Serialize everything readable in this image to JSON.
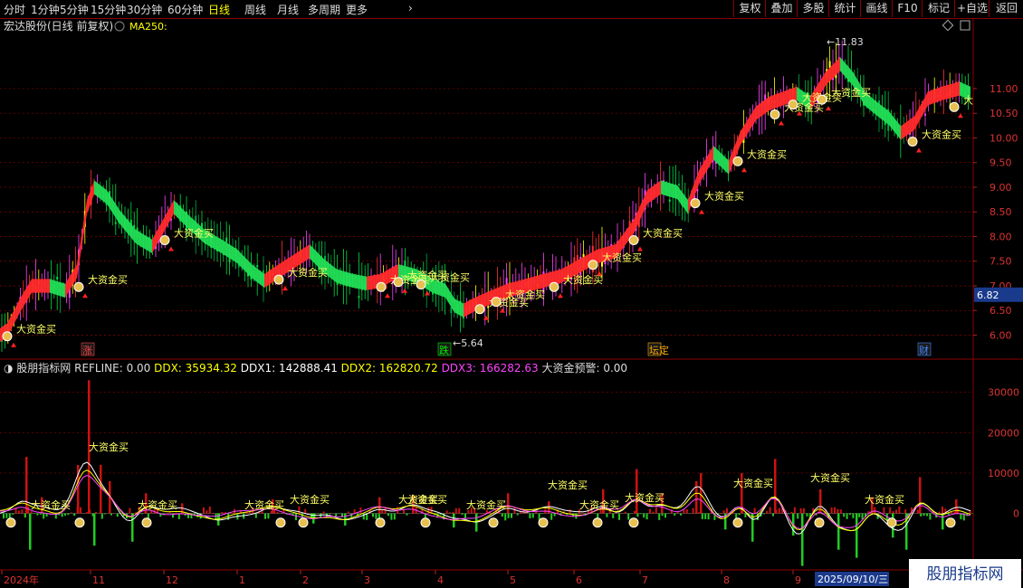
{
  "toolbar": {
    "periods": [
      "分时",
      "1分钟",
      "5分钟",
      "15分钟",
      "30分钟",
      "60分钟",
      "日线",
      "周线",
      "月线",
      "多周期",
      "更多"
    ],
    "active_period": "日线",
    "right_buttons": [
      "复权",
      "叠加",
      "多股",
      "统计",
      "画线",
      "F10",
      "标记",
      "+自选",
      "返回"
    ]
  },
  "main_header": {
    "title": "宏达股份(日线 前复权)",
    "ma_label": "MA250:"
  },
  "sub_header": {
    "name": "股朋指标网",
    "items": [
      {
        "text": "REFLINE: 0.00",
        "color": "#dddddd"
      },
      {
        "text": "DDX: 35934.32",
        "color": "#ffff00"
      },
      {
        "text": "DDX1: 142888.41",
        "color": "#ffffff"
      },
      {
        "text": "DDX2: 162820.72",
        "color": "#ffff00"
      },
      {
        "text": "DDX3: 166282.63",
        "color": "#ff44ff"
      },
      {
        "text": "大资金预警: 0.00",
        "color": "#dddddd"
      }
    ]
  },
  "watermark": {
    "title": "股朋指标网",
    "url": "www.7gpzb.com"
  },
  "chart_data": [
    {
      "type": "candlestick",
      "yticks": [
        6.0,
        6.5,
        7.0,
        7.5,
        8.0,
        8.5,
        9.0,
        9.5,
        10.0,
        10.5,
        11.0
      ],
      "ylim": [
        5.55,
        12.1
      ],
      "current_price": "6.82",
      "annotations": {
        "high": "11.83",
        "low": "5.64"
      },
      "path_points": [
        [
          0,
          6.0
        ],
        [
          8,
          6.1
        ],
        [
          22,
          6.6
        ],
        [
          35,
          7.0
        ],
        [
          55,
          7.0
        ],
        [
          72,
          6.9
        ],
        [
          85,
          7.3
        ],
        [
          96,
          8.6
        ],
        [
          104,
          9.0
        ],
        [
          118,
          8.8
        ],
        [
          132,
          8.4
        ],
        [
          150,
          8.0
        ],
        [
          168,
          7.8
        ],
        [
          180,
          8.2
        ],
        [
          192,
          8.6
        ],
        [
          208,
          8.3
        ],
        [
          226,
          8.0
        ],
        [
          245,
          7.8
        ],
        [
          262,
          7.6
        ],
        [
          278,
          7.3
        ],
        [
          292,
          7.1
        ],
        [
          308,
          7.3
        ],
        [
          325,
          7.5
        ],
        [
          342,
          7.7
        ],
        [
          358,
          7.4
        ],
        [
          372,
          7.2
        ],
        [
          390,
          7.1
        ],
        [
          405,
          7.05
        ],
        [
          420,
          7.1
        ],
        [
          440,
          7.3
        ],
        [
          460,
          7.2
        ],
        [
          478,
          7.0
        ],
        [
          492,
          6.9
        ],
        [
          502,
          6.6
        ],
        [
          512,
          6.5
        ],
        [
          522,
          6.6
        ],
        [
          540,
          6.75
        ],
        [
          560,
          6.9
        ],
        [
          580,
          7.0
        ],
        [
          600,
          7.1
        ],
        [
          620,
          7.2
        ],
        [
          640,
          7.4
        ],
        [
          660,
          7.6
        ],
        [
          680,
          7.7
        ],
        [
          700,
          8.2
        ],
        [
          715,
          8.8
        ],
        [
          730,
          9.0
        ],
        [
          748,
          8.9
        ],
        [
          760,
          8.6
        ],
        [
          772,
          9.2
        ],
        [
          788,
          9.7
        ],
        [
          805,
          9.4
        ],
        [
          818,
          10.0
        ],
        [
          835,
          10.5
        ],
        [
          850,
          10.7
        ],
        [
          865,
          10.8
        ],
        [
          880,
          10.9
        ],
        [
          895,
          10.7
        ],
        [
          912,
          11.2
        ],
        [
          928,
          11.5
        ],
        [
          942,
          11.2
        ],
        [
          955,
          10.8
        ],
        [
          968,
          10.6
        ],
        [
          982,
          10.4
        ],
        [
          995,
          10.1
        ],
        [
          1010,
          10.3
        ],
        [
          1025,
          10.8
        ],
        [
          1040,
          10.9
        ],
        [
          1060,
          11.0
        ],
        [
          1072,
          10.9
        ]
      ],
      "signals": [
        {
          "x": 8,
          "price": 6.05,
          "text": "大资金买"
        },
        {
          "x": 87,
          "price": 7.05,
          "text": "大资金买"
        },
        {
          "x": 182,
          "price": 8.0,
          "text": "大资金买"
        },
        {
          "x": 308,
          "price": 7.2,
          "text": "大资金买"
        },
        {
          "x": 421,
          "price": 7.05,
          "text": "大资金买"
        },
        {
          "x": 440,
          "price": 7.15,
          "text": "大资金买"
        },
        {
          "x": 465,
          "price": 7.1,
          "text": "大资金买"
        },
        {
          "x": 530,
          "price": 6.6,
          "text": "大资金买"
        },
        {
          "x": 548,
          "price": 6.75,
          "text": "大资金买"
        },
        {
          "x": 612,
          "price": 7.05,
          "text": "大资金买"
        },
        {
          "x": 655,
          "price": 7.5,
          "text": "大资金买"
        },
        {
          "x": 700,
          "price": 8.0,
          "text": "大资金买"
        },
        {
          "x": 768,
          "price": 8.75,
          "text": "大资金买"
        },
        {
          "x": 815,
          "price": 9.6,
          "text": "大资金买"
        },
        {
          "x": 856,
          "price": 10.55,
          "text": "大资金买"
        },
        {
          "x": 876,
          "price": 10.75,
          "text": "大资金买"
        },
        {
          "x": 908,
          "price": 10.85,
          "text": "大资金买"
        },
        {
          "x": 1008,
          "price": 10.0,
          "text": "大资金买"
        },
        {
          "x": 1054,
          "price": 10.7,
          "text": "大"
        }
      ],
      "markers": [
        {
          "x": 96,
          "text": "涨",
          "color": "#ff4444"
        },
        {
          "x": 490,
          "text": "跌",
          "color": "#00ee00"
        },
        {
          "x": 722,
          "text": "坛定",
          "color": "#ffaa00"
        },
        {
          "x": 1020,
          "text": "财",
          "color": "#4488ff"
        }
      ]
    },
    {
      "type": "bar",
      "yticks": [
        0,
        10000,
        20000,
        30000
      ],
      "ylim": [
        -14000,
        38000
      ],
      "bars": [
        [
          28,
          14000
        ],
        [
          32,
          -9000
        ],
        [
          45,
          4000
        ],
        [
          85,
          12000
        ],
        [
          97,
          33000
        ],
        [
          103,
          -8000
        ],
        [
          110,
          12000
        ],
        [
          120,
          8000
        ],
        [
          145,
          -7000
        ],
        [
          160,
          5000
        ],
        [
          200,
          2500
        ],
        [
          240,
          -3000
        ],
        [
          300,
          3500
        ],
        [
          345,
          -2500
        ],
        [
          380,
          -3000
        ],
        [
          418,
          4000
        ],
        [
          455,
          4500
        ],
        [
          500,
          -3500
        ],
        [
          525,
          -4500
        ],
        [
          560,
          5000
        ],
        [
          605,
          3000
        ],
        [
          665,
          6000
        ],
        [
          702,
          11000
        ],
        [
          730,
          5000
        ],
        [
          768,
          8000
        ],
        [
          773,
          10000
        ],
        [
          800,
          -4000
        ],
        [
          818,
          10000
        ],
        [
          830,
          -7000
        ],
        [
          855,
          13500
        ],
        [
          875,
          -5500
        ],
        [
          885,
          -13000
        ],
        [
          905,
          6000
        ],
        [
          925,
          -9000
        ],
        [
          945,
          -11000
        ],
        [
          962,
          4000
        ],
        [
          985,
          -6000
        ],
        [
          1000,
          -9000
        ],
        [
          1015,
          9000
        ],
        [
          1040,
          -4000
        ],
        [
          1055,
          3500
        ]
      ],
      "signals": [
        {
          "x": 12,
          "value": -500,
          "text": "大资金买",
          "dx": 22,
          "dy": -8
        },
        {
          "x": 88,
          "value": -500,
          "text": "大资金买",
          "dx": 10,
          "dy": -72
        },
        {
          "x": 162,
          "value": -500,
          "text": "大资金买",
          "dx": -10,
          "dy": -8
        },
        {
          "x": 310,
          "value": -500,
          "text": "大资金买",
          "dx": -40,
          "dy": -8
        },
        {
          "x": 335,
          "value": -500,
          "text": "大资金买",
          "dx": -15,
          "dy": -14
        },
        {
          "x": 420,
          "value": -500,
          "text": "大资金买",
          "dx": 20,
          "dy": -14
        },
        {
          "x": 470,
          "value": -500,
          "text": "大资金买",
          "dx": -20,
          "dy": -14
        },
        {
          "x": 545,
          "value": -500,
          "text": "大资金买",
          "dx": -30,
          "dy": -8
        },
        {
          "x": 600,
          "value": -500,
          "text": "大资金买",
          "dx": 5,
          "dy": -30
        },
        {
          "x": 660,
          "value": -500,
          "text": "大资金买",
          "dx": -20,
          "dy": -8
        },
        {
          "x": 700,
          "value": -500,
          "text": "大资金买",
          "dx": -10,
          "dy": -16
        },
        {
          "x": 815,
          "value": -500,
          "text": "大资金买",
          "dx": -5,
          "dy": -32
        },
        {
          "x": 905,
          "value": -500,
          "text": "大资金买",
          "dx": -10,
          "dy": -38
        },
        {
          "x": 985,
          "value": -500,
          "text": "大资金买",
          "dx": -30,
          "dy": -14
        },
        {
          "x": 1050,
          "value": -500,
          "text": "",
          "dx": 0,
          "dy": 0
        }
      ]
    }
  ],
  "date_axis": {
    "labels": [
      "2024年",
      "11",
      "12",
      "1",
      "2",
      "3",
      "4",
      "5",
      "6",
      "7",
      "8",
      "9"
    ],
    "highlight": "2025/09/10/三"
  }
}
